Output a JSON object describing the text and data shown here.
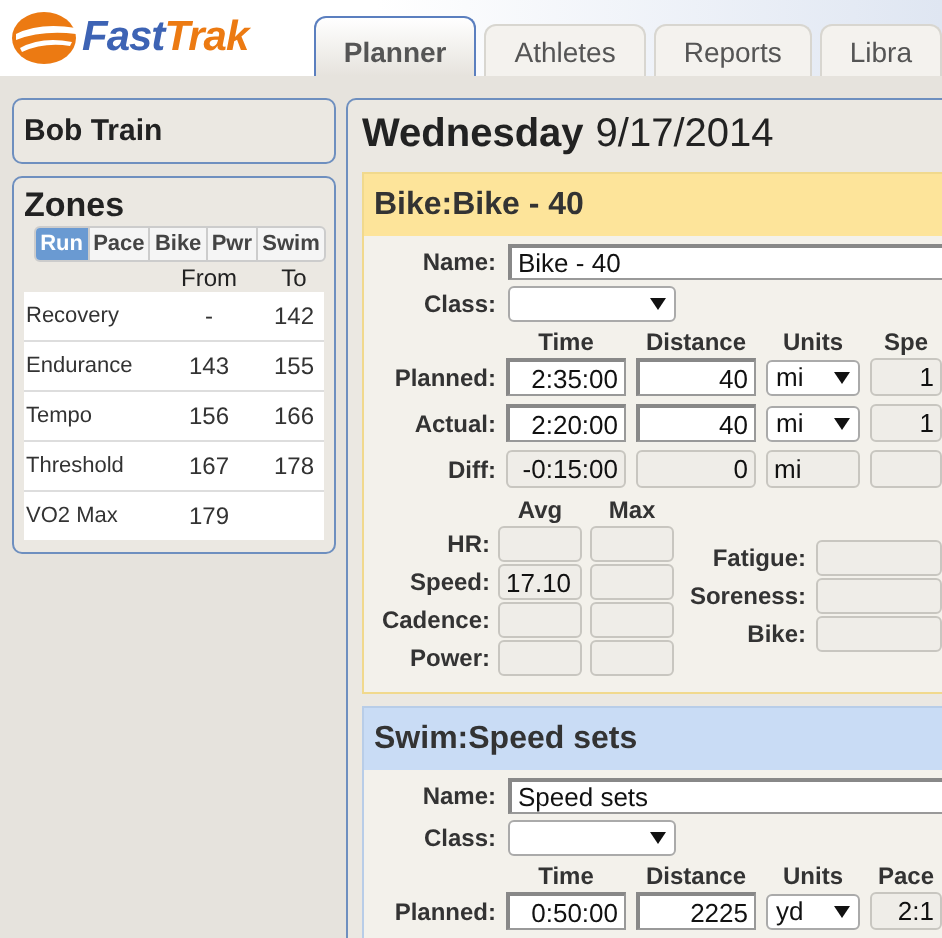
{
  "logo": {
    "parts": [
      {
        "text": "Fast",
        "color": "#3d63b4"
      },
      {
        "text": "Trak",
        "color": "#ec7a12"
      }
    ]
  },
  "tabs": [
    {
      "label": "Planner",
      "selected": true
    },
    {
      "label": "Athletes",
      "selected": false
    },
    {
      "label": "Reports",
      "selected": false
    },
    {
      "label": "Libra",
      "selected": false
    }
  ],
  "athlete": {
    "name": "Bob Train"
  },
  "zones": {
    "title": "Zones",
    "tabs": [
      {
        "label": "Run",
        "selected": true
      },
      {
        "label": "Pace",
        "selected": false
      },
      {
        "label": "Bike",
        "selected": false
      },
      {
        "label": "Pwr",
        "selected": false
      },
      {
        "label": "Swim",
        "selected": false
      }
    ],
    "columns": [
      "From",
      "To"
    ],
    "rows": [
      {
        "name": "Recovery",
        "from": "-",
        "to": "142"
      },
      {
        "name": "Endurance",
        "from": "143",
        "to": "155"
      },
      {
        "name": "Tempo",
        "from": "156",
        "to": "166"
      },
      {
        "name": "Threshold",
        "from": "167",
        "to": "178"
      },
      {
        "name": "VO2 Max",
        "from": "179"
      }
    ]
  },
  "day": {
    "weekday": "Wednesday",
    "date": "9/17/2014"
  },
  "workouts": [
    {
      "header": "Bike:Bike - 40",
      "color": "#fde49a",
      "name_label": "Name:",
      "name": "Bike - 40",
      "class_label": "Class:",
      "columns": [
        "Time",
        "Distance",
        "Units",
        "Spe"
      ],
      "rows": [
        {
          "label": "Planned:",
          "kind": "input",
          "time": "2:35:00",
          "distance": "40",
          "units": "mi",
          "rate": "1"
        },
        {
          "label": "Actual:",
          "kind": "input",
          "time": "2:20:00",
          "distance": "40",
          "units": "mi",
          "rate": "1"
        },
        {
          "label": "Diff:",
          "kind": "readonly",
          "time": "-0:15:00",
          "distance": "0",
          "units": "mi"
        }
      ],
      "metrics": {
        "columns": [
          "Avg",
          "Max"
        ],
        "rows": [
          {
            "label": "HR:"
          },
          {
            "label": "Speed:",
            "avg": "17.10"
          },
          {
            "label": "Cadence:"
          },
          {
            "label": "Power:"
          }
        ],
        "ratings": [
          {
            "label": "Fatigue:"
          },
          {
            "label": "Soreness:"
          },
          {
            "label": "Bike:"
          }
        ]
      }
    },
    {
      "header": "Swim:Speed sets",
      "color": "#c9dcf5",
      "name_label": "Name:",
      "name": "Speed sets",
      "class_label": "Class:",
      "columns": [
        "Time",
        "Distance",
        "Units",
        "Pace"
      ],
      "rows": [
        {
          "label": "Planned:",
          "kind": "input",
          "time": "0:50:00",
          "distance": "2225",
          "units": "yd",
          "rate": "2:1"
        }
      ]
    }
  ]
}
